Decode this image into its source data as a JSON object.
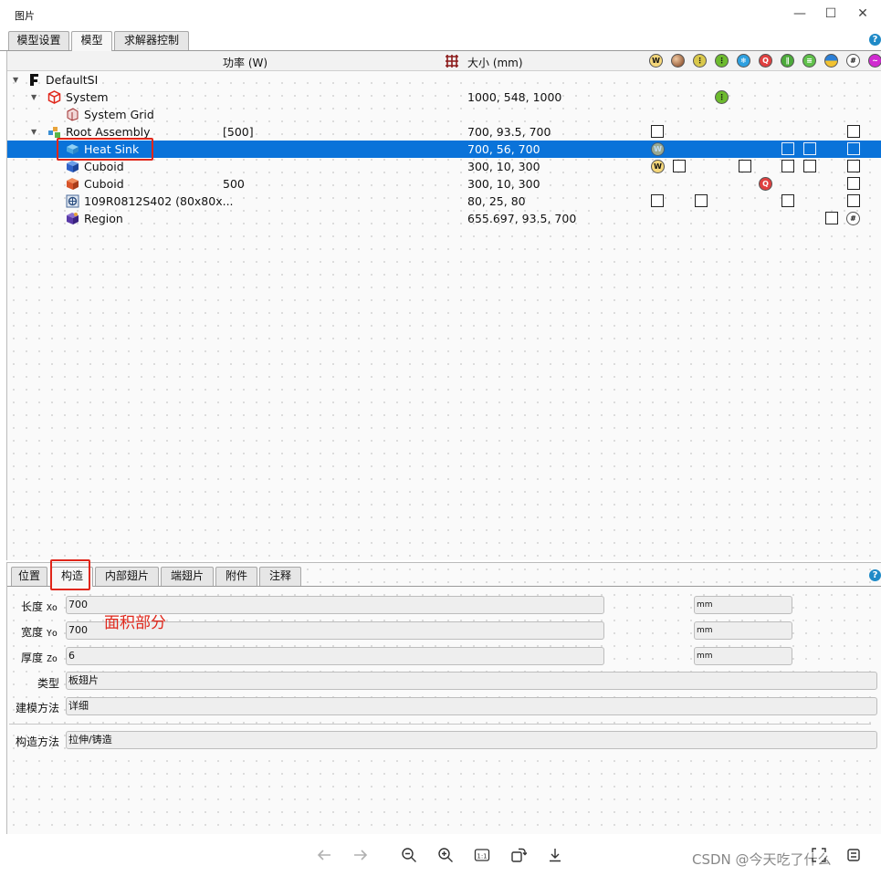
{
  "window": {
    "title": "图片"
  },
  "top_tabs": [
    {
      "label": "模型设置",
      "active": false
    },
    {
      "label": "模型",
      "active": true
    },
    {
      "label": "求解器控制",
      "active": false
    }
  ],
  "tree": {
    "headers": {
      "power": "功率 (W)",
      "size": "大小 (mm)"
    },
    "header_icons": [
      "source-icon",
      "material-icon",
      "radiation-icon",
      "resistance-icon",
      "snowflake-icon",
      "heat-flux-icon",
      "thermal-icon",
      "conductance-icon",
      "fluid-icon",
      "mesh-icon",
      "signal-icon"
    ],
    "rows": [
      {
        "name": "DefaultSI",
        "power": "",
        "size": ""
      },
      {
        "name": "System",
        "power": "",
        "size": "1000, 548, 1000"
      },
      {
        "name": "System Grid",
        "power": "",
        "size": ""
      },
      {
        "name": "Root Assembly",
        "power": "[500]",
        "size": "700, 93.5, 700"
      },
      {
        "name": "Heat Sink",
        "power": "",
        "size": "700, 56, 700",
        "selected": true
      },
      {
        "name": "Cuboid",
        "power": "",
        "size": "300, 10, 300"
      },
      {
        "name": "Cuboid",
        "power": "500",
        "size": "300, 10, 300"
      },
      {
        "name": "109R0812S402 (80x80x...",
        "power": "",
        "size": "80, 25, 80"
      },
      {
        "name": "Region",
        "power": "",
        "size": "655.697, 93.5, 700"
      }
    ]
  },
  "prop_tabs": [
    {
      "label": "位置",
      "active": false
    },
    {
      "label": "构造",
      "active": true
    },
    {
      "label": "内部翅片",
      "active": false
    },
    {
      "label": "端翅片",
      "active": false
    },
    {
      "label": "附件",
      "active": false
    },
    {
      "label": "注释",
      "active": false
    }
  ],
  "fields": {
    "length": {
      "label": "长度",
      "axis": "Xo",
      "value": "700",
      "unit": "mm"
    },
    "width": {
      "label": "宽度",
      "axis": "Yo",
      "value": "700",
      "unit": "mm"
    },
    "thickness": {
      "label": "厚度",
      "axis": "Zo",
      "value": "6",
      "unit": "mm"
    },
    "type": {
      "label": "类型",
      "value": "板翅片"
    },
    "modeling_method": {
      "label": "建模方法",
      "value": "详细"
    },
    "construction_method": {
      "label": "构造方法",
      "value": "拉伸/铸造"
    }
  },
  "annotation": "面积部分",
  "watermark": "CSDN @今天吃了什么",
  "colors": {
    "selection": "#0a73d9",
    "highlight": "#e0261a",
    "help": "#1f8ac7"
  }
}
